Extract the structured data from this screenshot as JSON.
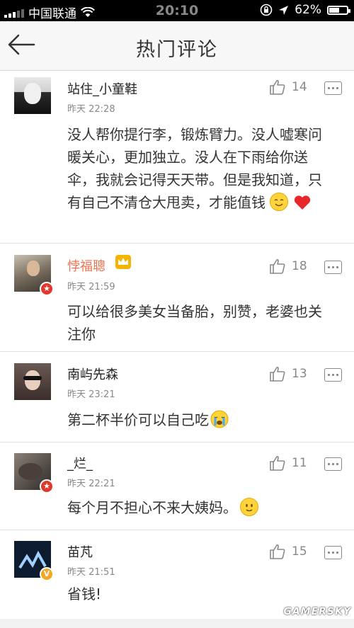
{
  "status_bar": {
    "carrier": "中国联通",
    "time": "20:10",
    "battery_pct": "62%",
    "battery_level": 0.62
  },
  "nav": {
    "title": "热门评论"
  },
  "comments": [
    {
      "username": "站住_小童鞋",
      "time": "昨天 22:28",
      "likes": "14",
      "text": "没人帮你提行李，锻炼臂力。没人嘘寒问暖关心，更加独立。没人在下雨给你送伞，我就会记得天天带。但是我知道，只有自己不清仓大甩卖，才能值钱",
      "badge": ""
    },
    {
      "username": "悖福聰",
      "time": "昨天 21:59",
      "likes": "18",
      "text": "可以给很多美女当备胎，别赞，老婆也关注你",
      "badge": "red"
    },
    {
      "username": "南屿先森",
      "time": "昨天 23:21",
      "likes": "13",
      "text": "第二杯半价可以自己吃",
      "badge": ""
    },
    {
      "username": "_烂_",
      "time": "昨天 22:21",
      "likes": "11",
      "text": "每个月不担心不来大姨妈。",
      "badge": "red"
    },
    {
      "username": "苗芃",
      "time": "昨天 21:51",
      "likes": "15",
      "text": "省钱!",
      "badge": "gold"
    }
  ],
  "watermark": "GAMERSKY",
  "colors": {
    "accent_orange": "#eb7350",
    "badge_red": "#e0392b",
    "badge_gold": "#f5a623"
  }
}
